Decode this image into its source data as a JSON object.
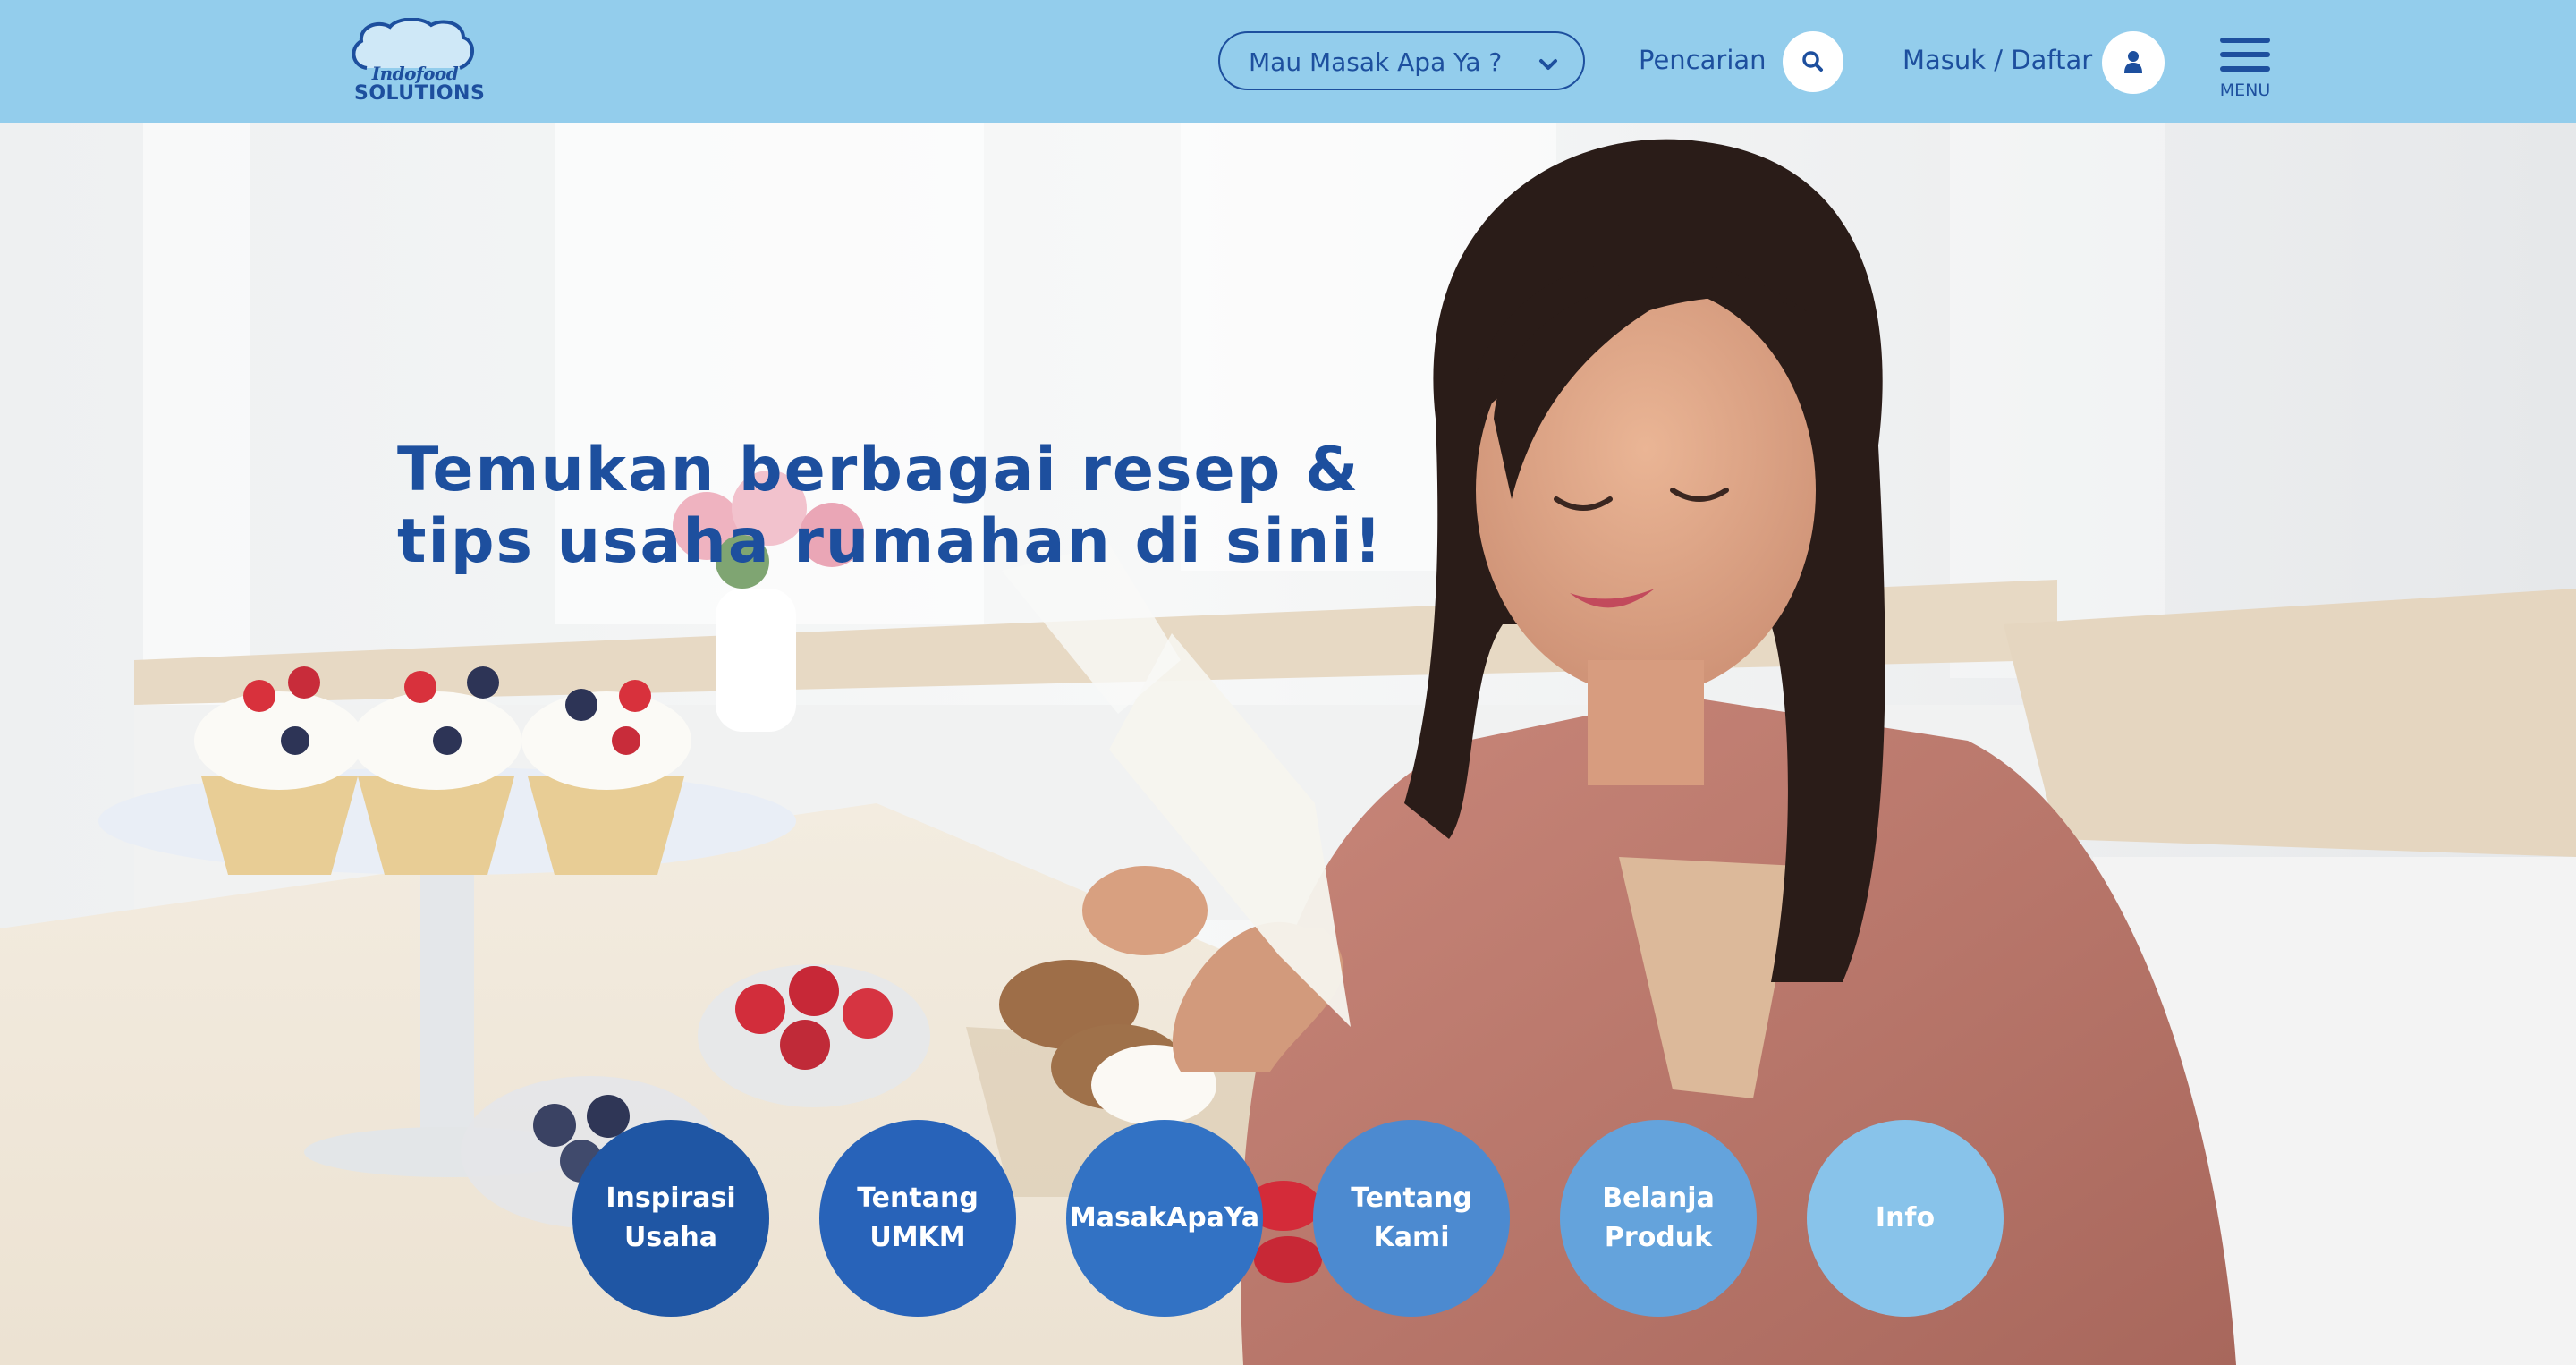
{
  "header": {
    "logo": {
      "line1": "Indofood",
      "line2": "SOLUTIONS"
    },
    "dropdown": {
      "label": "Mau Masak Apa Ya ?",
      "icon": "chevron-down-icon"
    },
    "search": {
      "label": "Pencarian",
      "icon": "search-icon"
    },
    "login": {
      "label": "Masuk / Daftar",
      "icon": "user-icon"
    },
    "menu": {
      "label": "MENU",
      "icon": "hamburger-icon"
    }
  },
  "hero": {
    "headline": {
      "line1": "Temukan berbagai resep &",
      "line2": "tips usaha rumahan di sini!"
    }
  },
  "nav_circles": [
    {
      "line1": "Inspirasi",
      "line2": "Usaha",
      "color": "#1f56a4"
    },
    {
      "line1": "Tentang",
      "line2": "UMKM",
      "color": "#2863b9"
    },
    {
      "line1": "MasakApaYa",
      "line2": "",
      "color": "#3272c4"
    },
    {
      "line1": "Tentang",
      "line2": "Kami",
      "color": "#4c8ad0"
    },
    {
      "line1": "Belanja",
      "line2": "Produk",
      "color": "#64a3dc"
    },
    {
      "line1": "Info",
      "line2": "",
      "color": "#88c3ea"
    }
  ],
  "colors": {
    "header_bg": "#93cdec",
    "brand_blue": "#1d4f9e"
  }
}
